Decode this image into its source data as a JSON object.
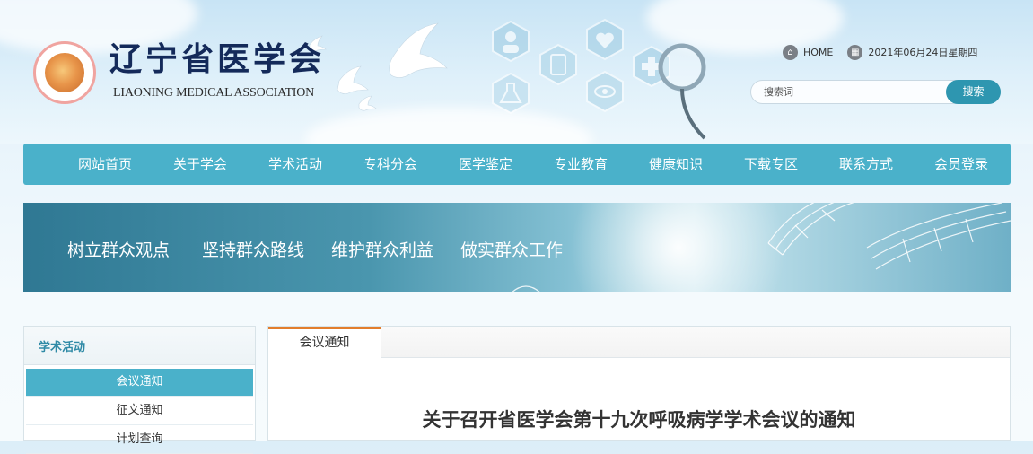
{
  "header": {
    "logo_cn": "辽宁省医学会",
    "logo_en": "LIAONING MEDICAL ASSOCIATION",
    "logo_icon": "association-seal-icon",
    "home_label": "HOME",
    "date_text": "2021年06月24日星期四"
  },
  "search": {
    "placeholder": "搜索词",
    "button_label": "搜索"
  },
  "nav": {
    "items": [
      "网站首页",
      "关于学会",
      "学术活动",
      "专科分会",
      "医学鉴定",
      "专业教育",
      "健康知识",
      "下载专区",
      "联系方式",
      "会员登录"
    ]
  },
  "banner": {
    "slogans": [
      "树立群众观点",
      "坚持群众路线",
      "维护群众利益",
      "做实群众工作"
    ]
  },
  "sidebar": {
    "title": "学术活动",
    "items": [
      "会议通知",
      "征文通知",
      "计划查询"
    ],
    "active_index": 0
  },
  "content": {
    "tab_label": "会议通知",
    "article_title": "关于召开省医学会第十九次呼吸病学学术会议的通知"
  },
  "colors": {
    "nav_bg": "#4ab1ca",
    "accent_tab": "#e27d2c",
    "search_button": "#2e96b0",
    "logo_text": "#142a5a"
  }
}
